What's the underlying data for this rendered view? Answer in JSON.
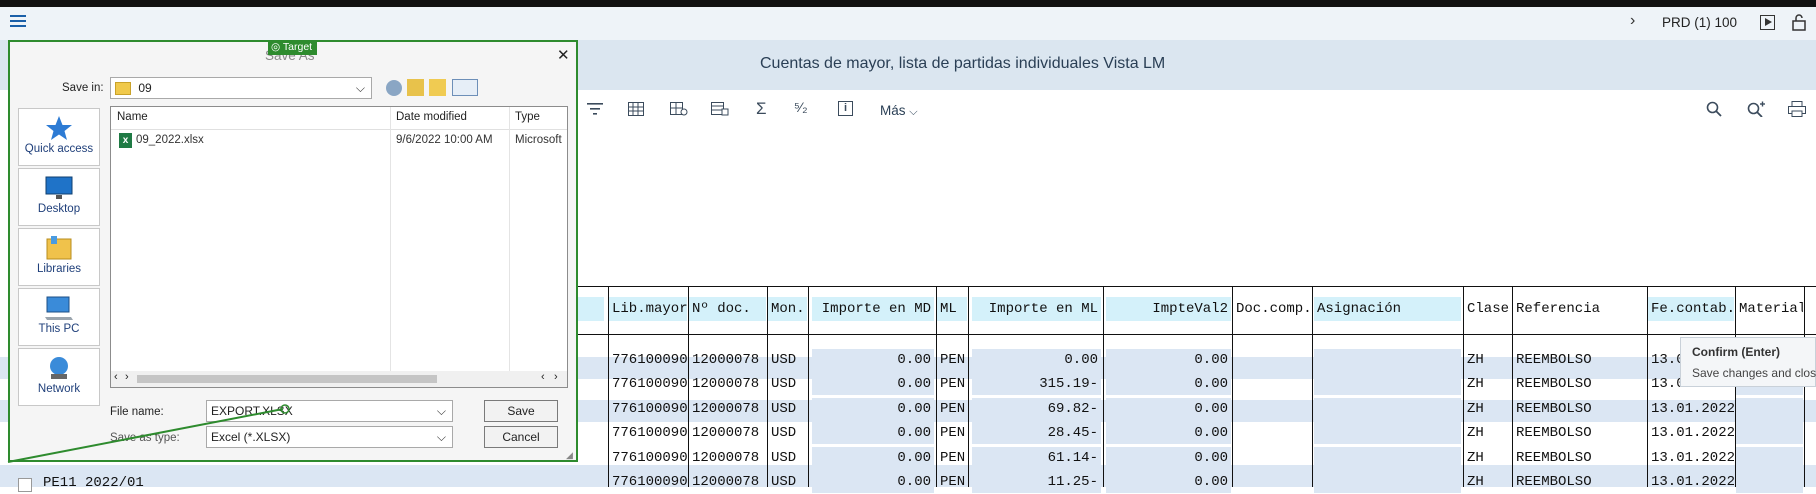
{
  "shell": {
    "menu_icon": "hamburger-icon",
    "system": "PRD (1) 100",
    "nav_icon": "chevron-right-icon"
  },
  "title": "Cuentas de mayor, lista de partidas individuales Vista LM",
  "toolbar": {
    "mas_label": "Más",
    "sum_symbol": "Σ",
    "subtotal_symbol": "⁵⁄₂",
    "info_symbol": "i"
  },
  "grid": {
    "headers": [
      "Lib.mayor",
      "Nº doc.",
      "Mon.",
      "Importe en MD",
      "ML",
      "Importe en ML",
      "ImpteVal2",
      "Doc.comp.",
      "Asignación",
      "Clase",
      "Referencia",
      "Fe.contab.",
      "Material"
    ],
    "rows": [
      {
        "lib": "776100090",
        "doc": "12000078",
        "mon": "USD",
        "md": "0.00",
        "ml": "PEN",
        "iml": "0.00",
        "v2": "0.00",
        "clase": "ZH",
        "ref": "REEMBOLSO",
        "fecha": "13.0"
      },
      {
        "lib": "776100090",
        "doc": "12000078",
        "mon": "USD",
        "md": "0.00",
        "ml": "PEN",
        "iml": "315.19-",
        "v2": "0.00",
        "clase": "ZH",
        "ref": "REEMBOLSO",
        "fecha": "13.0"
      },
      {
        "lib": "776100090",
        "doc": "12000078",
        "mon": "USD",
        "md": "0.00",
        "ml": "PEN",
        "iml": "69.82-",
        "v2": "0.00",
        "clase": "ZH",
        "ref": "REEMBOLSO",
        "fecha": "13.01.2022"
      },
      {
        "lib": "776100090",
        "doc": "12000078",
        "mon": "USD",
        "md": "0.00",
        "ml": "PEN",
        "iml": "28.45-",
        "v2": "0.00",
        "clase": "ZH",
        "ref": "REEMBOLSO",
        "fecha": "13.01.2022"
      },
      {
        "lib": "776100090",
        "doc": "12000078",
        "mon": "USD",
        "md": "0.00",
        "ml": "PEN",
        "iml": "61.14-",
        "v2": "0.00",
        "clase": "ZH",
        "ref": "REEMBOLSO",
        "fecha": "13.01.2022"
      },
      {
        "lib": "776100090",
        "doc": "12000078",
        "mon": "USD",
        "md": "0.00",
        "ml": "PEN",
        "iml": "11.25-",
        "v2": "0.00",
        "clase": "ZH",
        "ref": "REEMBOLSO",
        "fecha": "13.01.2022",
        "pre1": "PE11",
        "pre2": "2022/01"
      }
    ]
  },
  "tooltip": {
    "title": "Confirm (Enter)",
    "body": "Save changes and close"
  },
  "target_label": "Target",
  "dialog": {
    "title": "Save As",
    "save_in_label": "Save in:",
    "save_in_value": "09",
    "places": [
      "Quick access",
      "Desktop",
      "Libraries",
      "This PC",
      "Network"
    ],
    "columns": [
      "Name",
      "Date modified",
      "Type"
    ],
    "files": [
      {
        "name": "09_2022.xlsx",
        "date": "9/6/2022 10:00 AM",
        "type": "Microsoft"
      }
    ],
    "file_name_label": "File name:",
    "file_name_value": "EXPORT.XLSX",
    "save_type_label": "Save as type:",
    "save_type_value": "Excel (*.XLSX)",
    "save_button": "Save",
    "cancel_button": "Cancel",
    "close_symbol": "✕"
  },
  "colors": {
    "accent_green": "#2e8b2e",
    "header_cyan": "#d4f1fa",
    "row_blue": "#dbe6f3",
    "title_bg": "#dbe6f0"
  }
}
